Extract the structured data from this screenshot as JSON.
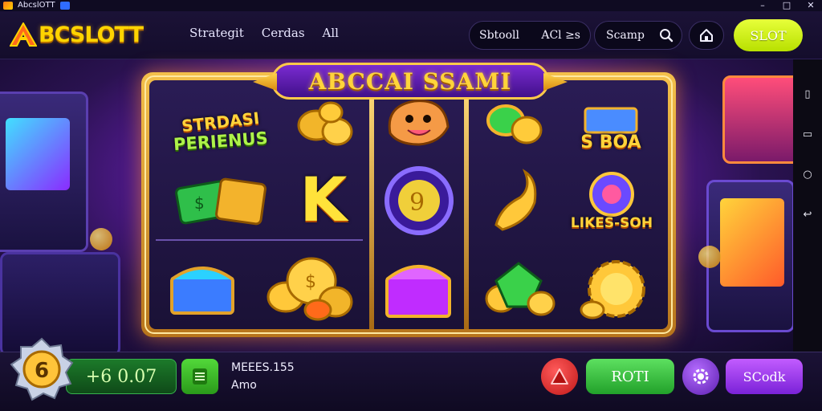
{
  "window": {
    "title": "AbcslOTT",
    "controls": {
      "minimize": "–",
      "maximize": "□",
      "close": "✕"
    }
  },
  "header": {
    "logo_text": "BCSLOTT",
    "nav": [
      "Strategit",
      "Cerdas",
      "All"
    ],
    "pill": {
      "value": "Sbtooll",
      "secondary": "ACl ≥s"
    },
    "search": {
      "placeholder": "Scamp"
    },
    "slot_button": "SLOT"
  },
  "machine": {
    "banner": "ABCCAI SSAMI",
    "symbols": {
      "strdasi_label_line1": "STRDASI",
      "strdasi_label_line2": "PERIENUS",
      "letter_k": "K",
      "sboa_label": "S BOA",
      "likes_label": "LIKES-SOH"
    }
  },
  "bottom": {
    "medal_value": "6",
    "balance": "+6 0.07",
    "info_line1": "MEEES.155",
    "info_line2": "Amo",
    "roll_button": "ROTI",
    "scroll_button": "SCodk"
  },
  "rail": [
    "▯",
    "▭",
    "○",
    "↩"
  ],
  "colors": {
    "gold": "#ffd43b",
    "slot_button": "#d4f51a",
    "roll_button": "#37c13d",
    "scroll_button": "#a040f0",
    "stop": "#e02222"
  },
  "icons": [
    "search-icon",
    "home-icon",
    "menu-icon",
    "stop-icon",
    "gear-icon",
    "medal-icon"
  ]
}
